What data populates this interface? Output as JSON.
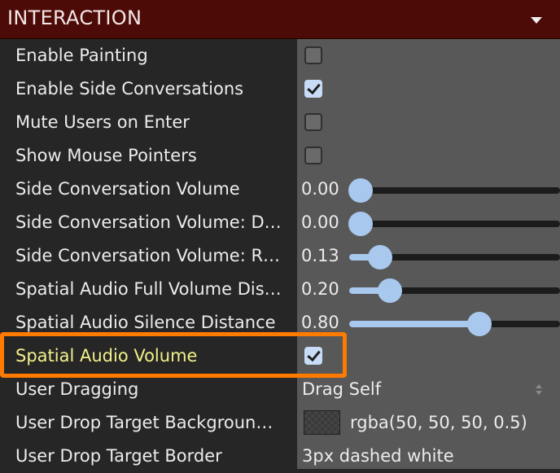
{
  "panel": {
    "title": "INTERACTION",
    "accent_color": "#4d0b07",
    "highlight_color": "#ff7a00"
  },
  "rows": [
    {
      "label": "Enable Painting",
      "type": "checkbox",
      "checked": false
    },
    {
      "label": "Enable Side Conversations",
      "type": "checkbox",
      "checked": true
    },
    {
      "label": "Mute Users on Enter",
      "type": "checkbox",
      "checked": false
    },
    {
      "label": "Show Mouse Pointers",
      "type": "checkbox",
      "checked": false
    },
    {
      "label": "Side Conversation Volume",
      "type": "slider",
      "value": "0.00",
      "fraction": 0.0
    },
    {
      "label": "Side Conversation Volume: D…",
      "type": "slider",
      "value": "0.00",
      "fraction": 0.0
    },
    {
      "label": "Side Conversation Volume: R…",
      "type": "slider",
      "value": "0.13",
      "fraction": 0.13
    },
    {
      "label": "Spatial Audio Full Volume Dis…",
      "type": "slider",
      "value": "0.20",
      "fraction": 0.2
    },
    {
      "label": "Spatial Audio Silence Distance",
      "type": "slider",
      "value": "0.80",
      "fraction": 0.8
    },
    {
      "label": "Spatial Audio Volume",
      "type": "checkbox",
      "checked": true,
      "highlighted": true
    },
    {
      "label": "User Dragging",
      "type": "select",
      "value": "Drag Self"
    },
    {
      "label": "User Drop Target Backgroun…",
      "type": "color",
      "value": "rgba(50, 50, 50, 0.5)"
    },
    {
      "label": "User Drop Target Border",
      "type": "text",
      "value": "3px dashed white"
    }
  ]
}
